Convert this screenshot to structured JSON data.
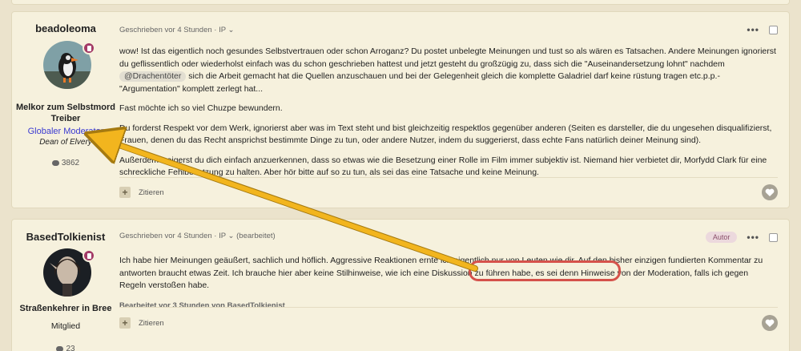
{
  "posts": [
    {
      "author": "beadoleoma",
      "rank": "Melkor zum Selbstmord Treiber",
      "group": "Globaler Moderator",
      "group_color": "#3a3ad1",
      "title": "Dean of Elvery",
      "post_count": "3862",
      "meta": "Geschrieben vor 4 Stunden · IP ⌄",
      "paragraphs": {
        "p1_before": "wow! Ist das eigentlich noch gesundes Selbstvertrauen oder schon Arroganz? Du postet unbelegte Meinungen und tust so als wären es Tatsachen. Andere Meinungen ignorierst du geflissentlich oder wiederholst einfach was du schon geschrieben hattest und jetzt gesteht du großzügig zu, dass sich die \"Auseinandersetzung lohnt\" nachdem ",
        "mention": "@Drachentöter",
        "p1_after": " sich die Arbeit gemacht hat die Quellen anzuschauen und bei der Gelegenheit gleich die komplette Galadriel darf keine rüstung tragen etc.p.p.-\"Argumentation\" komplett zerlegt hat...",
        "p2": "Fast möchte ich so viel Chuzpe bewundern.",
        "p3": "Du forderst Respekt vor dem Werk, ignorierst aber was im Text steht und bist gleichzeitig respektlos gegenüber anderen (Seiten es darsteller, die du ungesehen disqualifizierst, Frauen, denen du das Recht ansprichst bestimmte Dinge zu tun, oder andere Nutzer, indem du suggerierst, dass echte Fans natürlich deiner Meinung sind).",
        "p4": "Außerdem weigerst du dich einfach anzuerkennen, dass so etwas wie die Besetzung einer Rolle im Film immer subjektiv ist. Niemand hier verbietet dir, Morfydd Clark für eine schreckliche Fehlbesetzung zu halten. Aber hör bitte auf so zu tun, als sei das eine Tatsache und keine Meinung."
      },
      "quote_label": "Zitieren"
    },
    {
      "author": "BasedTolkienist",
      "rank": "Straßenkehrer in Bree",
      "group": "Mitglied",
      "group_color": "#222222",
      "post_count": "23",
      "meta": "Geschrieben vor 4 Stunden · IP ⌄ (bearbeitet)",
      "author_badge": "Autor",
      "paragraphs": {
        "p1_before": "Ich habe hier Meinungen geäußert, sachlich und höflich. Aggressive Reaktionen ernte ich eigentlich nur von Leuten wie dir. Auf den bisher einzigen fundierten Kommentar zu antworten braucht etwas Zeit. Ich brauche hier aber keine Stilhinweise, wie ich eine Diskussion zu führen habe, ",
        "highlighted": "es sei denn Hinweise von der Moderation,",
        "p1_after": " falls ich gegen Regeln verstoßen habe."
      },
      "edited": "Bearbeitet vor 3 Stunden von BasedTolkienist",
      "quote_label": "Zitieren"
    }
  ],
  "colors": {
    "background": "#ebe3cc",
    "post_bg": "#f6f1dd",
    "annotation_arrow": "#f2b51e",
    "annotation_highlight": "#d5524b"
  },
  "icons": {
    "more": "ellipsis-icon",
    "like": "heart-icon",
    "quote": "plus-icon",
    "posts": "comment-icon"
  }
}
